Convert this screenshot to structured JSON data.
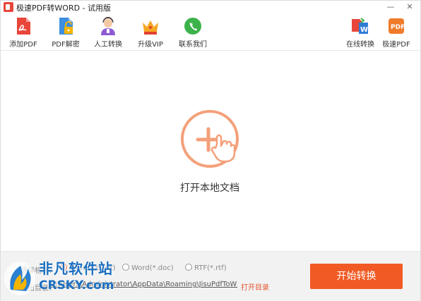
{
  "window": {
    "title": "极速PDF转WORD - 试用版",
    "controls": {
      "minimize": "—",
      "close": "✕"
    }
  },
  "toolbar": {
    "left": [
      {
        "label": "添加PDF",
        "icon": "add-pdf-icon"
      },
      {
        "label": "PDF解密",
        "icon": "pdf-unlock-icon"
      },
      {
        "label": "人工转换",
        "icon": "manual-convert-icon"
      },
      {
        "label": "升级VIP",
        "icon": "vip-crown-icon"
      },
      {
        "label": "联系我们",
        "icon": "contact-us-icon"
      }
    ],
    "right": [
      {
        "label": "在线转换",
        "icon": "online-convert-icon"
      },
      {
        "label": "极速PDF",
        "icon": "jisu-pdf-icon"
      }
    ]
  },
  "main": {
    "open_label": "打开本地文档",
    "open_icon": "add-hand-cursor-icon",
    "accent": "#f4a07a"
  },
  "bottom": {
    "format_label": "选择格式：",
    "formats": [
      {
        "label": "Word(*.docx)",
        "checked": true
      },
      {
        "label": "Word(*.doc)",
        "checked": false
      },
      {
        "label": "RTF(*.rtf)",
        "checked": false
      }
    ],
    "output_label": "输出目录：",
    "output_path": "C:\\Users\\Administrator\\AppData\\Roaming\\JisuPdfToWc",
    "open_dir": "打开目录",
    "start_button": "开始转换",
    "start_color": "#f15a24"
  },
  "watermark": {
    "line1": "非凡软件站",
    "line2": "CRSKY.com"
  }
}
